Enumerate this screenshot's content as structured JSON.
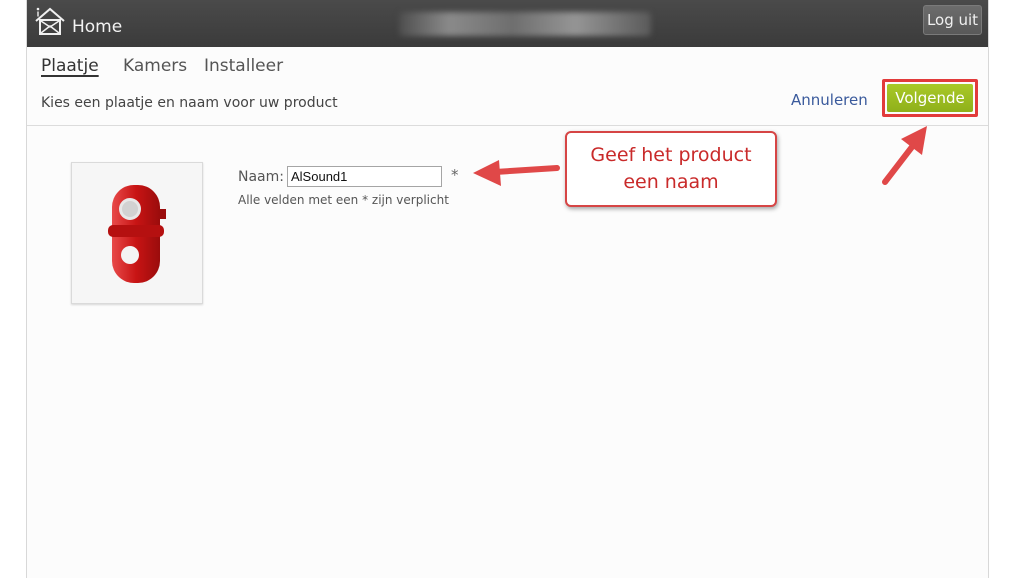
{
  "header": {
    "title": "Home",
    "logout_label": "Log uit"
  },
  "tabs": [
    {
      "label": "Plaatje",
      "active": true
    },
    {
      "label": "Kamers",
      "active": false
    },
    {
      "label": "Installeer",
      "active": false
    }
  ],
  "wizard": {
    "subtitle": "Kies een plaatje en naam voor uw product",
    "cancel_label": "Annuleren",
    "next_label": "Volgende"
  },
  "form": {
    "name_label": "Naam:",
    "name_value": "AlSound1",
    "required_marker": "*",
    "required_note": "Alle velden met een * zijn verplicht"
  },
  "annotation": {
    "line1": "Geef het product",
    "line2": "een naam"
  },
  "colors": {
    "accent_green": "#9bbb22",
    "annotation_red": "#d64545",
    "topbar": "#404040",
    "link_blue": "#3a5a9c"
  }
}
